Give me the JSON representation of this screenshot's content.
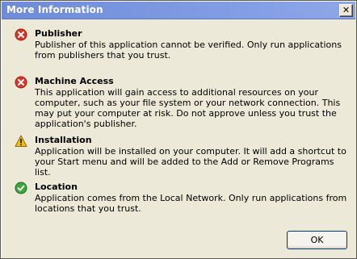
{
  "window": {
    "title": "More Information",
    "close_label": "✕"
  },
  "sections": [
    {
      "icon": "error-icon",
      "heading": "Publisher",
      "body": "Publisher of this application cannot be verified. Only run applications from publishers that you trust."
    },
    {
      "icon": "error-icon",
      "heading": "Machine Access",
      "body": "This application will gain access to additional resources on your computer, such as your file system or your network connection. This may put your computer at risk. Do not approve unless you trust the application's publisher."
    },
    {
      "icon": "warning-icon",
      "heading": "Installation",
      "body": "Application will be installed on your computer. It will add a shortcut to your Start menu and will be added to the Add or Remove Programs list."
    },
    {
      "icon": "check-icon",
      "heading": "Location",
      "body": "Application comes from the Local Network. Only run applications from locations that you trust."
    }
  ],
  "buttons": {
    "ok_label": "OK"
  },
  "colors": {
    "error": "#d9362b",
    "warning": "#f2c200",
    "success": "#3aa53a",
    "titlebar": "#7a96df",
    "dialog_bg": "#ece9d8"
  }
}
